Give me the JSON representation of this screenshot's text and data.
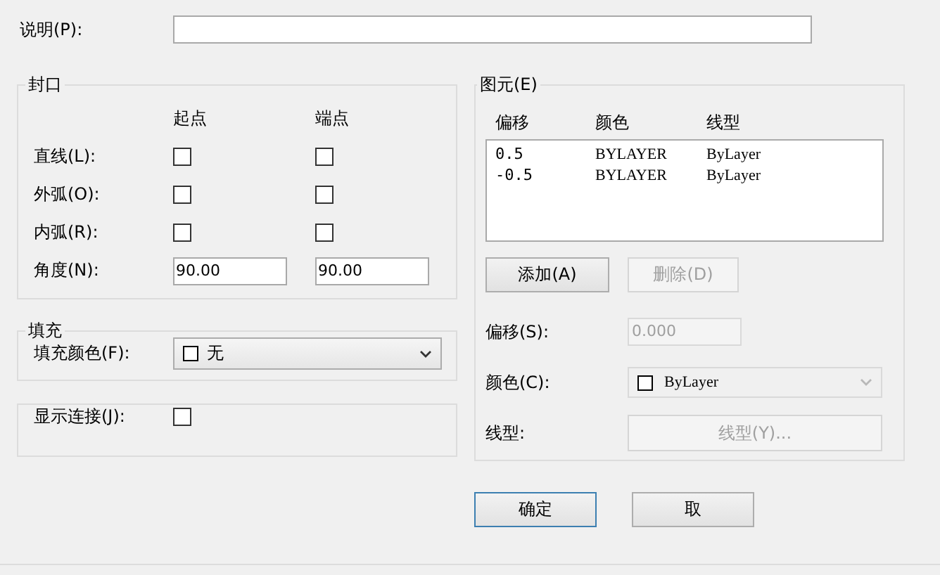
{
  "description": {
    "label": "说明(P):"
  },
  "caps": {
    "title": "封口",
    "columns": [
      "起点",
      "端点"
    ],
    "rows": [
      {
        "kind": "checkbox",
        "label": "直线(L):",
        "start": {
          "checked": false
        },
        "end": {
          "checked": false
        }
      },
      {
        "kind": "checkbox",
        "label": "外弧(O):",
        "start": {
          "checked": false
        },
        "end": {
          "checked": false
        }
      },
      {
        "kind": "checkbox",
        "label": "内弧(R):",
        "start": {
          "checked": false
        },
        "end": {
          "checked": false
        }
      },
      {
        "kind": "field",
        "label": "角度(N):",
        "start": {
          "value": "90.00"
        },
        "end": {
          "value": "90.00"
        }
      }
    ]
  },
  "fill": {
    "title": "填充",
    "label": "填充颜色(F):",
    "value": "无"
  },
  "display_joints": {
    "label": "显示连接(J):",
    "checked": false
  },
  "elements": {
    "title": "图元(E)",
    "columns": [
      "偏移",
      "颜色",
      "线型"
    ],
    "rows": [
      {
        "cells": [
          "0.5",
          "BYLAYER",
          "ByLayer"
        ],
        "selected": false
      },
      {
        "cells": [
          "-0.5",
          "BYLAYER",
          "ByLayer"
        ],
        "selected": false
      }
    ],
    "add_button": {
      "label": "添加(A)",
      "disabled": false
    },
    "delete_button": {
      "label": "删除(D)",
      "disabled": true
    },
    "offset": {
      "label": "偏移(S):",
      "value": "0.000",
      "disabled": true
    },
    "color": {
      "label": "颜色(C):",
      "value": "ByLayer",
      "disabled": true
    },
    "linetype": {
      "label": "线型:",
      "button": "线型(Y)...",
      "disabled": true
    }
  },
  "buttons": [
    {
      "label": "确定",
      "default": true
    },
    {
      "label": "取",
      "default": false
    }
  ]
}
